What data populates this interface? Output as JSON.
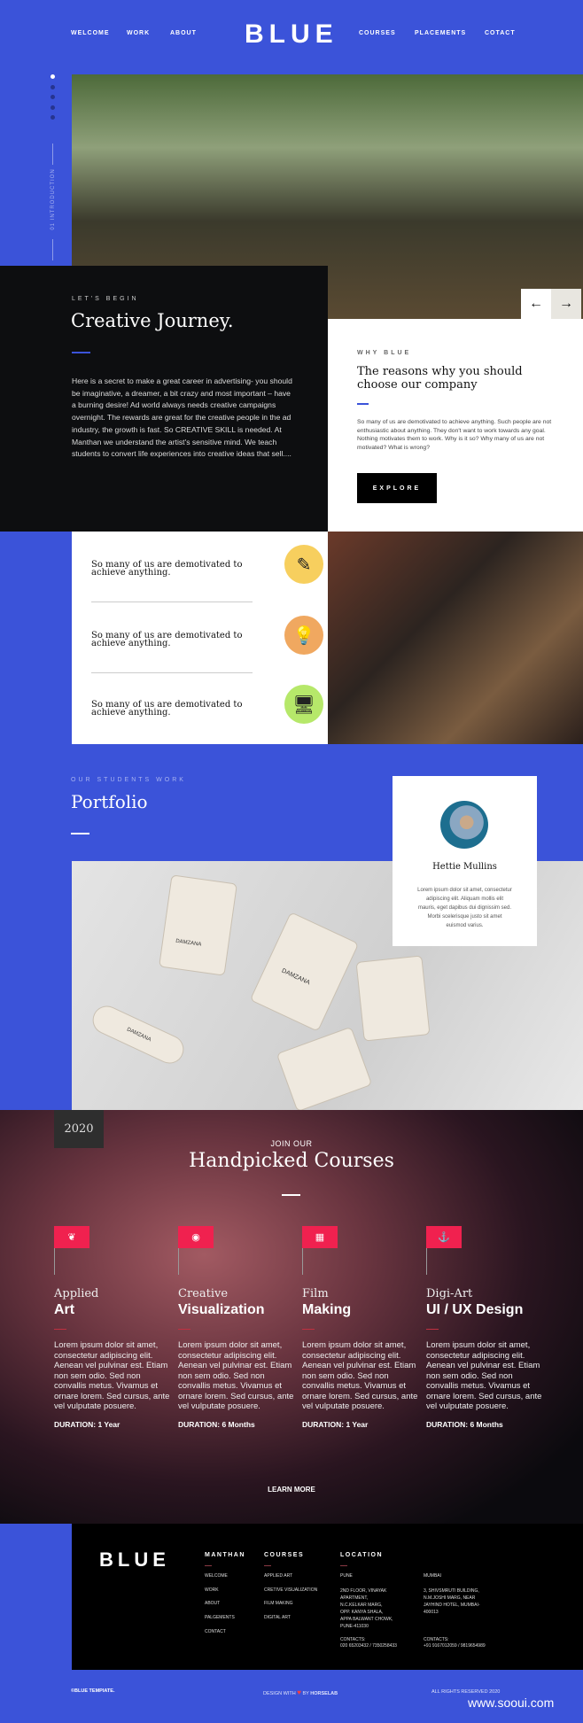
{
  "colors": {
    "brand": "#3b53d9",
    "accent": "#f0214f",
    "dark": "#0d0e10"
  },
  "nav": {
    "left": [
      "WELCOME",
      "WORK",
      "ABOUT"
    ],
    "logo": "BLUE",
    "right": [
      "COURSES",
      "PLACEMENTS",
      "COTACT"
    ]
  },
  "side": {
    "label": "01 INTRODUCTION",
    "slides": 5,
    "active": 1
  },
  "intro": {
    "eyebrow": "LET'S BEGIN",
    "title": "Creative Journey.",
    "body": "Here is a secret to make a great career in advertising- you should be imaginative, a dreamer, a bit crazy and most important – have a burning desire! Ad world always needs creative campaigns overnight. The rewards are great for the creative people in the ad industry, the growth is fast. So CREATIVE SKILL is needed. At Manthan we understand the artist's sensitive mind. We  teach students to convert life experiences into creative ideas that sell...."
  },
  "why": {
    "eyebrow": "WHY BLUE",
    "title": "The reasons why you should choose our company",
    "body": "So many of us are demotivated to achieve anything. Such people are not enthusiastic about anything. They don't want to work towards any goal. Nothing motivates them to work. Why is it so? Why many of us are not motivated? What is wrong?",
    "button": "EXPLORE",
    "prev": "←",
    "next": "→"
  },
  "features": [
    {
      "text": "So many of us are demotivated to achieve anything.",
      "icon": "pencil-cup-icon",
      "color": "#f7cf5e",
      "glyph": "✎"
    },
    {
      "text": "So many of us are demotivated to achieve anything.",
      "icon": "lightbulb-icon",
      "color": "#f0a860",
      "glyph": "💡"
    },
    {
      "text": "So many of us are demotivated to achieve anything.",
      "icon": "monitor-image-icon",
      "color": "#b6e86a",
      "glyph": "🖥"
    }
  ],
  "portfolio": {
    "eyebrow": "OUR STUDENTS WORK",
    "title": "Portfolio",
    "card": {
      "name": "Hettie Mullins",
      "body": "Lorem ipsum dolor sit amet, consectetur adipiscing elit. Aliquam mollis elit mauris, eget dapibus dui dignissim sed. Morbi scelerisque justo sit amet euismod varius."
    },
    "labels": [
      "DAMZANA",
      "DAMZANA",
      "DAMZANA"
    ]
  },
  "courses": {
    "year": "2020",
    "eyebrow": "JOIN OUR",
    "title": "Handpicked Courses",
    "more": "LEARN MORE",
    "items": [
      {
        "sub": "Applied",
        "title": "Art",
        "icon": "feather-icon",
        "glyph": "❦",
        "body": "Lorem ipsum dolor sit amet, consectetur adipiscing elit. Aenean vel pulvinar est. Etiam non sem odio. Sed non convallis metus. Vivamus et ornare lorem. Sed cursus, ante vel vulputate posuere.",
        "duration_label": "DURATION:",
        "duration": "1 Year"
      },
      {
        "sub": "Creative",
        "title": "Visualization",
        "icon": "eye-icon",
        "glyph": "◉",
        "body": "Lorem ipsum dolor sit amet, consectetur adipiscing elit. Aenean vel pulvinar est. Etiam non sem odio. Sed non convallis metus. Vivamus et ornare lorem. Sed cursus, ante vel vulputate posuere.",
        "duration_label": "DURATION:",
        "duration": "6 Months"
      },
      {
        "sub": "Film",
        "title": "Making",
        "icon": "film-icon",
        "glyph": "▦",
        "body": "Lorem ipsum dolor sit amet, consectetur adipiscing elit. Aenean vel pulvinar est. Etiam non sem odio. Sed non convallis metus. Vivamus et ornare lorem. Sed cursus, ante vel vulputate posuere.",
        "duration_label": "DURATION:",
        "duration": "1 Year"
      },
      {
        "sub": "Digi-Art",
        "title": "UI / UX Design",
        "icon": "anchor-icon",
        "glyph": "⚓",
        "body": "Lorem ipsum dolor sit amet, consectetur adipiscing elit. Aenean vel pulvinar est. Etiam non sem odio. Sed non convallis metus. Vivamus et ornare lorem. Sed cursus, ante vel vulputate posuere.",
        "duration_label": "DURATION:",
        "duration": "6 Months"
      }
    ]
  },
  "footer": {
    "logo": "BLUE",
    "manthan": {
      "title": "MANTHAN",
      "links": [
        "WELCOME",
        "WORK",
        "ABOUT",
        "PALGEMENTS",
        "CONTACT"
      ]
    },
    "courses": {
      "title": "COURSES",
      "links": [
        "APPLIED  ART",
        "CRETIVE VISUALIZATION",
        "FILM MAKING",
        "DIGITAL ART"
      ]
    },
    "location": {
      "title": "LOCATION",
      "pune": {
        "city": "PUNE",
        "address": "2ND FLOOR, VINAYAK APARTMENT, N.C.KELKAR MARG, OPP. KANYA SHALA, APPA BALWANT CHOWK, PUNE-411030",
        "contacts_label": "CONTACTS:",
        "contacts": "020 65203432 / 7350258433"
      },
      "mumbai": {
        "city": "MUMBAI",
        "address": "3, SHIVSMRUTI BUILDING, N.M.JOSHI MARG, NEAR JAYHIND HOTEL, MUMBAI-400013",
        "contacts_label": "CONTACTS:",
        "contacts": "+91 9167012059 / 9819654989"
      }
    }
  },
  "bottom": {
    "copyright": "©BLUE TEMPIATE.",
    "design_with": "DESIGN WITH",
    "heart": "♥",
    "by": "BY",
    "brand": "HORSELAB",
    "rights": "ALL RIGHTS RESERVED 2020",
    "watermark": "www.sooui.com"
  }
}
